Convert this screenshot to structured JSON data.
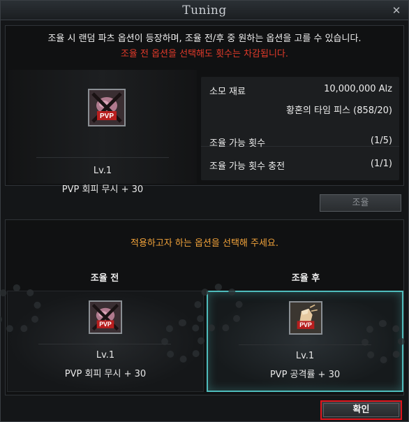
{
  "window": {
    "title": "Tuning",
    "close_glyph": "✕"
  },
  "notice": {
    "line1": "조율 시 랜덤 파츠 옵션이 등장하며, 조율 전/후 중 원하는 옵션을 고를 수 있습니다.",
    "line2": "조율 전 옵션을 선택해도 횟수는 차감됩니다.",
    "line2_color": "#e23a2a"
  },
  "current_item": {
    "icon": "pvp-evasion-ignore-icon",
    "level": "Lv.1",
    "name": "PVP 회피 무시  + 30"
  },
  "info": {
    "cost_label": "소모 재료",
    "cost_value": "10,000,000 Alz",
    "material": "황혼의 타임 피스 (858/20)",
    "count_label": "조율 가능 횟수",
    "count_value": "(1/5)",
    "recharge_label": "조율 가능 횟수 충전",
    "recharge_value": "(1/1)"
  },
  "tune_button": {
    "label": "조율"
  },
  "selection": {
    "message": "적용하고자 하는 옵션을 선택해 주세요.",
    "message_color": "#f2a33a",
    "before": {
      "header": "조율 전",
      "icon": "pvp-evasion-ignore-icon",
      "level": "Lv.1",
      "name": "PVP 회피 무시  + 30"
    },
    "after": {
      "header": "조율 후",
      "icon": "pvp-attack-rate-icon",
      "level": "Lv.1",
      "name": "PVP 공격률  + 30",
      "selected": true
    }
  },
  "confirm_button": {
    "label": "확인"
  },
  "colors": {
    "accent_selected": "#4fbcbc",
    "highlight_red": "#e0141b"
  }
}
